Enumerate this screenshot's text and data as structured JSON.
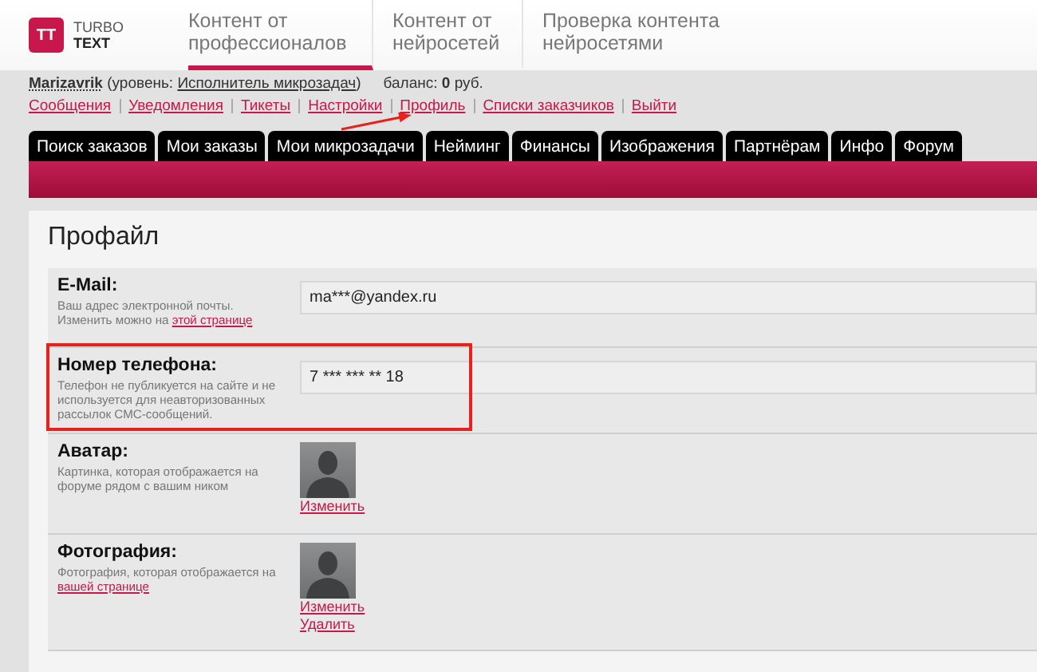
{
  "header": {
    "logo": {
      "mark": "TT",
      "line1": "TURBO",
      "line2": "TEXT"
    },
    "nav": [
      {
        "label": "Контент от профессионалов",
        "selected": true
      },
      {
        "label": "Контент от нейросетей",
        "selected": false
      },
      {
        "label": "Проверка контента нейросетями",
        "selected": false
      }
    ]
  },
  "user": {
    "name": "Marizavrik",
    "level_prefix": "(уровень:",
    "level": "Исполнитель микрозадач",
    "level_suffix": ")",
    "balance": "баланс: **0** руб."
  },
  "links": [
    "Сообщения",
    "Уведомления",
    "Тикеты",
    "Настройки",
    "Профиль",
    "Списки заказчиков",
    "Выйти"
  ],
  "annotations": [
    {
      "kind": "arrow"
    }
  ],
  "tabs": [
    "Поиск заказов",
    "Мои заказы",
    "Мои микрозадачи",
    "Нейминг",
    "Финансы",
    "Изображения",
    "Партнёрам",
    "Инфо",
    "Форум"
  ],
  "page_title": "Профайл",
  "fields": [
    {
      "kind": "text",
      "label": "E-Mail:",
      "hint": "Ваш адрес электронной почты. Изменить можно на ",
      "hint_link": "этой странице",
      "value": "ma***@yandex.ru",
      "highlighted": false
    },
    {
      "kind": "text",
      "label": "Номер телефона:",
      "hint": "Телефон не публикуется на сайте и не используется для неавторизованных рассылок СМС-сообщений.",
      "value": "7 *** *** ** 18",
      "highlighted": true
    },
    {
      "kind": "image",
      "label": "Аватар:",
      "hint": "Картинка, которая отображается на форуме рядом с вашим ником",
      "actions": [
        "Изменить"
      ],
      "highlighted": false
    },
    {
      "kind": "image",
      "label": "Фотография:",
      "hint": "Фотография, которая отображается на ",
      "hint_link": "вашей странице",
      "actions": [
        "Изменить",
        "Удалить"
      ],
      "highlighted": false
    }
  ]
}
